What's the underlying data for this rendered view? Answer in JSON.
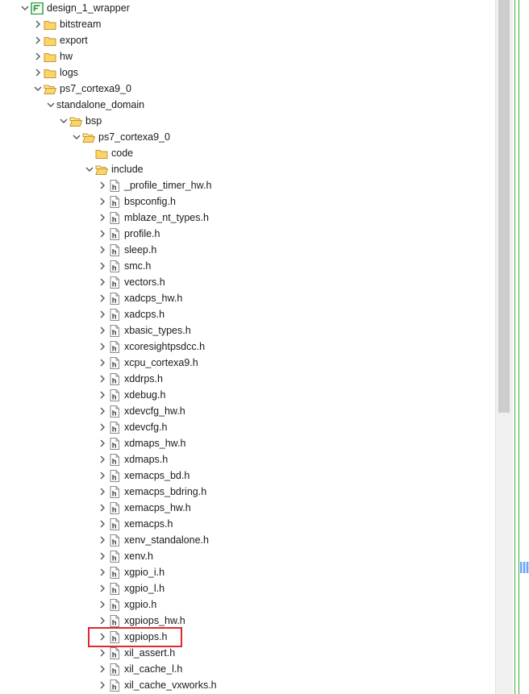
{
  "tree": [
    {
      "label": "design_1_wrapper",
      "depth": 0,
      "icon": "project",
      "expanded": true
    },
    {
      "label": "bitstream",
      "depth": 1,
      "icon": "folder",
      "expanded": false
    },
    {
      "label": "export",
      "depth": 1,
      "icon": "folder",
      "expanded": false
    },
    {
      "label": "hw",
      "depth": 1,
      "icon": "folder",
      "expanded": false
    },
    {
      "label": "logs",
      "depth": 1,
      "icon": "folder",
      "expanded": false
    },
    {
      "label": "ps7_cortexa9_0",
      "depth": 1,
      "icon": "folder-open",
      "expanded": true
    },
    {
      "label": "standalone_domain",
      "depth": 2,
      "icon": "none",
      "expanded": true
    },
    {
      "label": "bsp",
      "depth": 3,
      "icon": "folder-open",
      "expanded": true
    },
    {
      "label": "ps7_cortexa9_0",
      "depth": 4,
      "icon": "folder-open",
      "expanded": true
    },
    {
      "label": "code",
      "depth": 5,
      "icon": "folder",
      "expanded": null
    },
    {
      "label": "include",
      "depth": 5,
      "icon": "folder-open",
      "expanded": true
    },
    {
      "label": "_profile_timer_hw.h",
      "depth": 6,
      "icon": "h-file",
      "expanded": false
    },
    {
      "label": "bspconfig.h",
      "depth": 6,
      "icon": "h-file",
      "expanded": false
    },
    {
      "label": "mblaze_nt_types.h",
      "depth": 6,
      "icon": "h-file",
      "expanded": false
    },
    {
      "label": "profile.h",
      "depth": 6,
      "icon": "h-file",
      "expanded": false
    },
    {
      "label": "sleep.h",
      "depth": 6,
      "icon": "h-file",
      "expanded": false
    },
    {
      "label": "smc.h",
      "depth": 6,
      "icon": "h-file",
      "expanded": false
    },
    {
      "label": "vectors.h",
      "depth": 6,
      "icon": "h-file",
      "expanded": false
    },
    {
      "label": "xadcps_hw.h",
      "depth": 6,
      "icon": "h-file",
      "expanded": false
    },
    {
      "label": "xadcps.h",
      "depth": 6,
      "icon": "h-file",
      "expanded": false
    },
    {
      "label": "xbasic_types.h",
      "depth": 6,
      "icon": "h-file",
      "expanded": false
    },
    {
      "label": "xcoresightpsdcc.h",
      "depth": 6,
      "icon": "h-file",
      "expanded": false
    },
    {
      "label": "xcpu_cortexa9.h",
      "depth": 6,
      "icon": "h-file",
      "expanded": false
    },
    {
      "label": "xddrps.h",
      "depth": 6,
      "icon": "h-file",
      "expanded": false
    },
    {
      "label": "xdebug.h",
      "depth": 6,
      "icon": "h-file",
      "expanded": false
    },
    {
      "label": "xdevcfg_hw.h",
      "depth": 6,
      "icon": "h-file",
      "expanded": false
    },
    {
      "label": "xdevcfg.h",
      "depth": 6,
      "icon": "h-file",
      "expanded": false
    },
    {
      "label": "xdmaps_hw.h",
      "depth": 6,
      "icon": "h-file",
      "expanded": false
    },
    {
      "label": "xdmaps.h",
      "depth": 6,
      "icon": "h-file",
      "expanded": false
    },
    {
      "label": "xemacps_bd.h",
      "depth": 6,
      "icon": "h-file",
      "expanded": false
    },
    {
      "label": "xemacps_bdring.h",
      "depth": 6,
      "icon": "h-file",
      "expanded": false
    },
    {
      "label": "xemacps_hw.h",
      "depth": 6,
      "icon": "h-file",
      "expanded": false
    },
    {
      "label": "xemacps.h",
      "depth": 6,
      "icon": "h-file",
      "expanded": false
    },
    {
      "label": "xenv_standalone.h",
      "depth": 6,
      "icon": "h-file",
      "expanded": false
    },
    {
      "label": "xenv.h",
      "depth": 6,
      "icon": "h-file",
      "expanded": false
    },
    {
      "label": "xgpio_i.h",
      "depth": 6,
      "icon": "h-file",
      "expanded": false
    },
    {
      "label": "xgpio_l.h",
      "depth": 6,
      "icon": "h-file",
      "expanded": false
    },
    {
      "label": "xgpio.h",
      "depth": 6,
      "icon": "h-file",
      "expanded": false
    },
    {
      "label": "xgpiops_hw.h",
      "depth": 6,
      "icon": "h-file",
      "expanded": false
    },
    {
      "label": "xgpiops.h",
      "depth": 6,
      "icon": "h-file",
      "expanded": false,
      "highlighted": true
    },
    {
      "label": "xil_assert.h",
      "depth": 6,
      "icon": "h-file",
      "expanded": false
    },
    {
      "label": "xil_cache_l.h",
      "depth": 6,
      "icon": "h-file",
      "expanded": false
    },
    {
      "label": "xil_cache_vxworks.h",
      "depth": 6,
      "icon": "h-file",
      "expanded": false
    }
  ],
  "colors": {
    "folder_fill": "#fbd46a",
    "folder_stroke": "#c8962b",
    "project_green": "#2e9e3e",
    "chevron": "#555555",
    "highlight_box": "#e0282e",
    "scroll_thumb": "#cdcdcd",
    "edge_green": "#3fae3f"
  },
  "h_file_glyph": "h"
}
